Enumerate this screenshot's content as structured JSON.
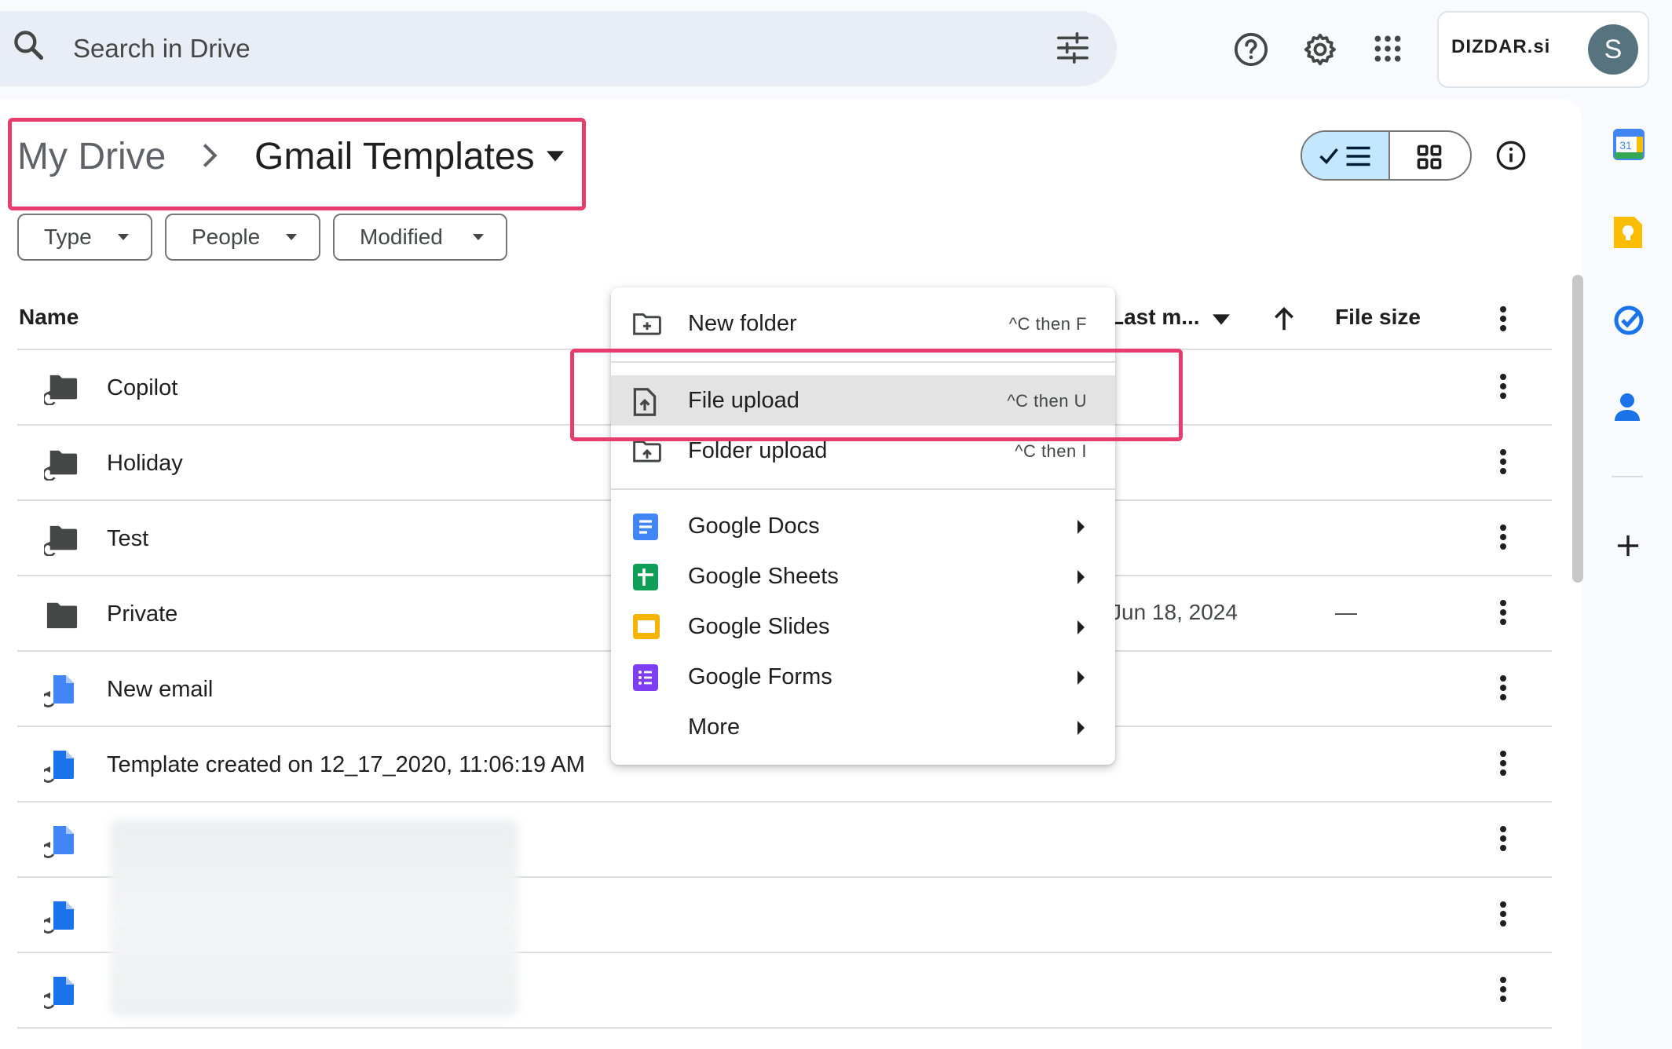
{
  "search": {
    "placeholder": "Search in Drive"
  },
  "account": {
    "brand": "DIZDAR.si",
    "avatar_letter": "S"
  },
  "breadcrumb": {
    "root": "My Drive",
    "current": "Gmail Templates"
  },
  "filters": {
    "type": "Type",
    "people": "People",
    "modified": "Modified"
  },
  "table": {
    "headers": {
      "name": "Name",
      "last_modified": "Last m...",
      "file_size": "File size"
    },
    "rows": [
      {
        "name": "Copilot",
        "icon": "shared-folder-icon",
        "date": "",
        "size": ""
      },
      {
        "name": "Holiday",
        "icon": "shared-folder-icon",
        "date": "",
        "size": ""
      },
      {
        "name": "Test",
        "icon": "shared-folder-icon",
        "date": "",
        "size": ""
      },
      {
        "name": "Private",
        "icon": "folder-icon",
        "date": "Jun 18, 2024",
        "size": "—"
      },
      {
        "name": "New email",
        "icon": "shortcut-doc-icon",
        "date": "",
        "size": ""
      },
      {
        "name": "Template created on 12_17_2020, 11:06:19 AM",
        "icon": "shortcut-doc-icon",
        "date": "",
        "size": ""
      },
      {
        "name": "",
        "icon": "shortcut-doc-icon",
        "date": "",
        "size": ""
      },
      {
        "name": "",
        "icon": "shortcut-doc-icon",
        "date": "",
        "size": ""
      },
      {
        "name": "",
        "icon": "shortcut-doc-icon",
        "date": "",
        "size": ""
      }
    ]
  },
  "menu": {
    "new_folder": {
      "label": "New folder",
      "shortcut": "^C then F"
    },
    "file_upload": {
      "label": "File upload",
      "shortcut": "^C then U"
    },
    "folder_upload": {
      "label": "Folder upload",
      "shortcut": "^C then I"
    },
    "docs": {
      "label": "Google Docs"
    },
    "sheets": {
      "label": "Google Sheets"
    },
    "slides": {
      "label": "Google Slides"
    },
    "forms": {
      "label": "Google Forms"
    },
    "more": {
      "label": "More"
    }
  },
  "colors": {
    "highlight": "#e63d6d",
    "accent": "#c2e7ff",
    "docs": "#4285f4",
    "sheets": "#0f9d58",
    "slides": "#f4b400",
    "forms": "#7e3ff2"
  }
}
